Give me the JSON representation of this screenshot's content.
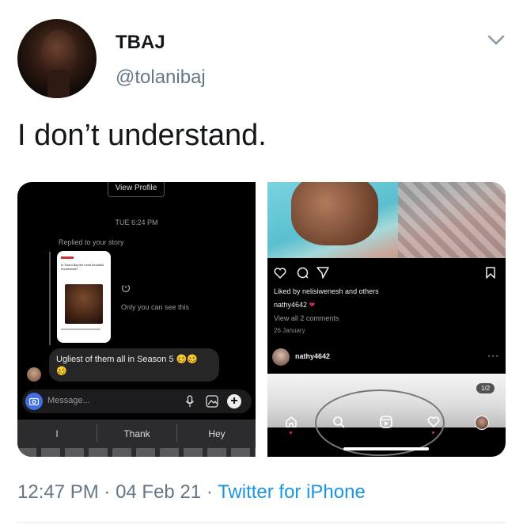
{
  "author": {
    "name": "TBAJ",
    "handle": "@tolanibaj"
  },
  "tweet": {
    "text": "I don’t understand."
  },
  "dm_screenshot": {
    "view_profile": "View Profile",
    "timestamp": "TUE 6:24 PM",
    "replied": "Replied to your story",
    "only_you": "Only you can see this",
    "story_headline": "Is Tolani Baj the most beautiful housemate?",
    "message": "Ugliest of them all in Season 5 🥴🥴\n🥴",
    "composer_placeholder": "Message...",
    "suggestions": [
      "I",
      "Thank",
      "Hey"
    ]
  },
  "ig_screenshot": {
    "liked_by": "Liked by nelisiwenesh and others",
    "caption_user": "nathy4642",
    "view_comments": "View all 2 comments",
    "date": "26 January",
    "post_user": "nathy4642",
    "counter": "1/2"
  },
  "meta": {
    "time": "12:47 PM",
    "sep1": " · ",
    "date": "04 Feb 21",
    "sep2": " · ",
    "source": "Twitter for iPhone"
  }
}
